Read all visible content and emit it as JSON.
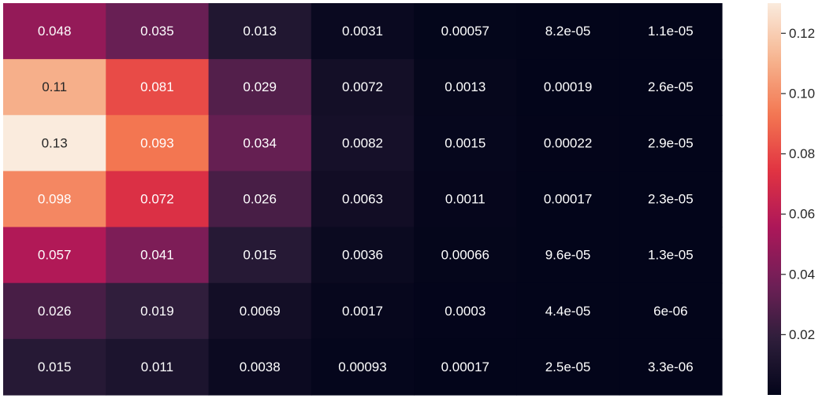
{
  "chart_data": {
    "type": "heatmap",
    "title": "",
    "xlabel": "",
    "ylabel": "",
    "grid": false,
    "values": [
      [
        0.048,
        0.035,
        0.013,
        0.0031,
        0.00057,
        8.2e-05,
        1.1e-05
      ],
      [
        0.11,
        0.081,
        0.029,
        0.0072,
        0.0013,
        0.00019,
        2.6e-05
      ],
      [
        0.13,
        0.093,
        0.034,
        0.0082,
        0.0015,
        0.00022,
        2.9e-05
      ],
      [
        0.098,
        0.072,
        0.026,
        0.0063,
        0.0011,
        0.00017,
        2.3e-05
      ],
      [
        0.057,
        0.041,
        0.015,
        0.0036,
        0.00066,
        9.6e-05,
        1.3e-05
      ],
      [
        0.026,
        0.019,
        0.0069,
        0.0017,
        0.0003,
        4.4e-05,
        6e-06
      ],
      [
        0.015,
        0.011,
        0.0038,
        0.00093,
        0.00017,
        2.5e-05,
        3.3e-06
      ]
    ],
    "annotations": [
      [
        "0.048",
        "0.035",
        "0.013",
        "0.0031",
        "0.00057",
        "8.2e-05",
        "1.1e-05"
      ],
      [
        "0.11",
        "0.081",
        "0.029",
        "0.0072",
        "0.0013",
        "0.00019",
        "2.6e-05"
      ],
      [
        "0.13",
        "0.093",
        "0.034",
        "0.0082",
        "0.0015",
        "0.00022",
        "2.9e-05"
      ],
      [
        "0.098",
        "0.072",
        "0.026",
        "0.0063",
        "0.0011",
        "0.00017",
        "2.3e-05"
      ],
      [
        "0.057",
        "0.041",
        "0.015",
        "0.0036",
        "0.00066",
        "9.6e-05",
        "1.3e-05"
      ],
      [
        "0.026",
        "0.019",
        "0.0069",
        "0.0017",
        "0.0003",
        "4.4e-05",
        "6e-06"
      ],
      [
        "0.015",
        "0.011",
        "0.0038",
        "0.00093",
        "0.00017",
        "2.5e-05",
        "3.3e-06"
      ]
    ],
    "colorbar": {
      "range": [
        0,
        0.13
      ],
      "ticks": [
        0.02,
        0.04,
        0.06,
        0.08,
        0.1,
        0.12
      ],
      "tick_labels": [
        "0.02",
        "0.04",
        "0.06",
        "0.08",
        "0.10",
        "0.12"
      ]
    },
    "colormap": {
      "name": "rocket",
      "stops": [
        "#03051a",
        "#2e1e3b",
        "#701f57",
        "#ad1759",
        "#e13342",
        "#f37651",
        "#f6b48f",
        "#faebdd"
      ]
    }
  }
}
